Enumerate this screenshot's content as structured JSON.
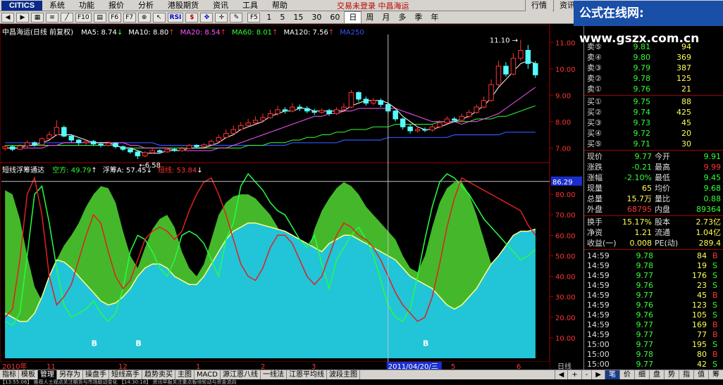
{
  "menubar": {
    "logo": "CITICS",
    "items": [
      "系统",
      "功能",
      "报价",
      "分析",
      "港股期货",
      "资讯",
      "工具",
      "帮助"
    ],
    "status": "交易未登录  中昌海运",
    "right_buttons": [
      "行情",
      "资讯"
    ]
  },
  "toolbar": {
    "icons": [
      "back-icon",
      "forward-icon",
      "grid-icon",
      "list-icon",
      "chart-icon",
      "f10-icon",
      "draw-icon",
      "f6-icon",
      "f7-icon",
      "zoom-icon",
      "cursor-icon",
      "rsi-icon",
      "dollar-icon",
      "move-icon",
      "cross-icon",
      "pen-icon"
    ],
    "btn_labels": [
      "",
      "",
      "",
      "",
      "",
      "F10",
      "",
      "F6",
      "F7",
      "",
      "",
      "RSI",
      "$",
      "",
      "",
      ""
    ],
    "f5": "F5",
    "periods": [
      "1",
      "5",
      "15",
      "30",
      "60",
      "日",
      "周",
      "月",
      "多",
      "季",
      "年"
    ],
    "active_period": "日"
  },
  "watermark": "公式在线网: www.gszx.com.cn",
  "main_chart": {
    "title": "中昌海运(日线 前复权)",
    "ma": [
      {
        "label": "MA5: 8.74",
        "arrow": "↓",
        "color": "#ffffff"
      },
      {
        "label": "MA10: 8.80",
        "arrow": "↑",
        "color": "#ffffff"
      },
      {
        "label": "MA20: 8.54",
        "arrow": "↑",
        "color": "#ff55ff"
      },
      {
        "label": "MA60: 8.01",
        "arrow": "↑",
        "color": "#33ff33"
      },
      {
        "label": "MA120: 7.56",
        "arrow": "↑",
        "color": "#ffffff"
      },
      {
        "label": "MA250",
        "arrow": "",
        "color": "#3355ff"
      }
    ],
    "y_ticks": [
      "11.00",
      "10.00",
      "9.00",
      "8.00",
      "7.00"
    ],
    "high_label": "11.10",
    "low_label": "6.58",
    "up_color": "#ff3333",
    "down_color": "#55ffff"
  },
  "indicator": {
    "name": "短线浮筹通达",
    "fields": [
      {
        "label": "空方: 49.79",
        "arrow": "↑",
        "color": "#33ff33"
      },
      {
        "label": "浮筹A: 57.45",
        "arrow": "↓",
        "color": "#ffffff"
      },
      {
        "label": "短线: 53.84",
        "arrow": "↓",
        "color": "#ff3333"
      }
    ],
    "cursor_value": "86.29",
    "y_ticks": [
      "80.00",
      "70.00",
      "60.00",
      "50.00",
      "40.00",
      "30.00",
      "20.00",
      "10.00"
    ],
    "b_marker": "B"
  },
  "x_axis": {
    "labels": [
      "2010年",
      "11",
      "12",
      "1",
      "2",
      "3",
      "4",
      "5",
      "6"
    ],
    "cursor_date": "2011/04/20/三",
    "period": "日线"
  },
  "chart_data": {
    "type": "candlestick",
    "price_range": [
      6.5,
      11.3
    ],
    "indicator_range": [
      0,
      90
    ],
    "candles": [
      {
        "o": 6.98,
        "c": 7.05,
        "h": 7.12,
        "l": 6.9
      },
      {
        "o": 7.05,
        "c": 6.95,
        "h": 7.1,
        "l": 6.88
      },
      {
        "o": 6.95,
        "c": 7.08,
        "h": 7.15,
        "l": 6.92
      },
      {
        "o": 7.08,
        "c": 7.2,
        "h": 7.28,
        "l": 7.02
      },
      {
        "o": 7.2,
        "c": 7.12,
        "h": 7.25,
        "l": 7.05
      },
      {
        "o": 7.12,
        "c": 7.35,
        "h": 7.4,
        "l": 7.1
      },
      {
        "o": 7.35,
        "c": 7.5,
        "h": 7.62,
        "l": 7.3
      },
      {
        "o": 7.5,
        "c": 7.78,
        "h": 8.05,
        "l": 7.45
      },
      {
        "o": 7.78,
        "c": 7.45,
        "h": 7.85,
        "l": 7.4
      },
      {
        "o": 7.45,
        "c": 7.3,
        "h": 7.5,
        "l": 7.22
      },
      {
        "o": 7.3,
        "c": 7.2,
        "h": 7.35,
        "l": 7.1
      },
      {
        "o": 7.2,
        "c": 7.25,
        "h": 7.32,
        "l": 7.12
      },
      {
        "o": 7.25,
        "c": 7.15,
        "h": 7.3,
        "l": 7.08
      },
      {
        "o": 7.15,
        "c": 7.1,
        "h": 7.22,
        "l": 7.02
      },
      {
        "o": 7.1,
        "c": 7.18,
        "h": 7.25,
        "l": 7.05
      },
      {
        "o": 7.18,
        "c": 7.05,
        "h": 7.22,
        "l": 6.98
      },
      {
        "o": 7.05,
        "c": 6.95,
        "h": 7.1,
        "l": 6.88
      },
      {
        "o": 6.95,
        "c": 6.85,
        "h": 7.0,
        "l": 6.78
      },
      {
        "o": 6.85,
        "c": 6.7,
        "h": 6.9,
        "l": 6.58
      },
      {
        "o": 6.7,
        "c": 6.82,
        "h": 6.88,
        "l": 6.65
      },
      {
        "o": 6.82,
        "c": 6.9,
        "h": 6.98,
        "l": 6.78
      },
      {
        "o": 6.9,
        "c": 6.85,
        "h": 6.95,
        "l": 6.8
      },
      {
        "o": 6.85,
        "c": 6.95,
        "h": 7.02,
        "l": 6.82
      },
      {
        "o": 6.95,
        "c": 6.9,
        "h": 7.0,
        "l": 6.85
      },
      {
        "o": 6.9,
        "c": 6.98,
        "h": 7.05,
        "l": 6.86
      },
      {
        "o": 6.98,
        "c": 7.1,
        "h": 7.15,
        "l": 6.95
      },
      {
        "o": 7.1,
        "c": 7.05,
        "h": 7.14,
        "l": 7.0
      },
      {
        "o": 7.05,
        "c": 7.12,
        "h": 7.18,
        "l": 7.02
      },
      {
        "o": 7.12,
        "c": 7.25,
        "h": 7.32,
        "l": 7.1
      },
      {
        "o": 7.25,
        "c": 7.4,
        "h": 7.5,
        "l": 7.22
      },
      {
        "o": 7.4,
        "c": 7.55,
        "h": 7.7,
        "l": 7.35
      },
      {
        "o": 7.55,
        "c": 7.7,
        "h": 7.85,
        "l": 7.5
      },
      {
        "o": 7.7,
        "c": 7.85,
        "h": 7.98,
        "l": 7.65
      },
      {
        "o": 7.85,
        "c": 7.95,
        "h": 8.1,
        "l": 7.78
      },
      {
        "o": 7.95,
        "c": 8.05,
        "h": 8.2,
        "l": 7.9
      },
      {
        "o": 8.05,
        "c": 8.15,
        "h": 8.3,
        "l": 8.0
      },
      {
        "o": 8.15,
        "c": 8.3,
        "h": 8.45,
        "l": 8.1
      },
      {
        "o": 8.3,
        "c": 8.45,
        "h": 8.6,
        "l": 8.22
      },
      {
        "o": 8.45,
        "c": 8.4,
        "h": 8.55,
        "l": 8.3
      },
      {
        "o": 8.4,
        "c": 8.55,
        "h": 8.7,
        "l": 8.35
      },
      {
        "o": 8.55,
        "c": 8.5,
        "h": 8.65,
        "l": 8.4
      },
      {
        "o": 8.5,
        "c": 8.4,
        "h": 8.58,
        "l": 8.32
      },
      {
        "o": 8.4,
        "c": 8.35,
        "h": 8.48,
        "l": 8.25
      },
      {
        "o": 8.35,
        "c": 8.42,
        "h": 8.5,
        "l": 8.3
      },
      {
        "o": 8.42,
        "c": 8.3,
        "h": 8.48,
        "l": 8.22
      },
      {
        "o": 8.3,
        "c": 8.45,
        "h": 8.55,
        "l": 8.25
      },
      {
        "o": 8.45,
        "c": 8.55,
        "h": 8.7,
        "l": 8.4
      },
      {
        "o": 8.55,
        "c": 9.1,
        "h": 9.2,
        "l": 8.5
      },
      {
        "o": 9.1,
        "c": 8.85,
        "h": 9.15,
        "l": 8.75
      },
      {
        "o": 8.85,
        "c": 8.7,
        "h": 8.95,
        "l": 8.6
      },
      {
        "o": 8.7,
        "c": 8.8,
        "h": 8.9,
        "l": 8.62
      },
      {
        "o": 8.8,
        "c": 8.65,
        "h": 8.88,
        "l": 8.55
      },
      {
        "o": 8.65,
        "c": 8.4,
        "h": 8.7,
        "l": 8.3
      },
      {
        "o": 8.4,
        "c": 8.1,
        "h": 8.45,
        "l": 8.0
      },
      {
        "o": 8.1,
        "c": 7.8,
        "h": 8.15,
        "l": 7.7
      },
      {
        "o": 7.8,
        "c": 7.65,
        "h": 7.9,
        "l": 7.55
      },
      {
        "o": 7.65,
        "c": 7.7,
        "h": 7.8,
        "l": 7.58
      },
      {
        "o": 7.7,
        "c": 7.68,
        "h": 7.78,
        "l": 7.6
      },
      {
        "o": 7.68,
        "c": 7.8,
        "h": 7.9,
        "l": 7.62
      },
      {
        "o": 7.8,
        "c": 7.95,
        "h": 8.05,
        "l": 7.75
      },
      {
        "o": 7.95,
        "c": 8.1,
        "h": 8.2,
        "l": 7.9
      },
      {
        "o": 8.1,
        "c": 8.05,
        "h": 8.18,
        "l": 7.98
      },
      {
        "o": 8.05,
        "c": 8.2,
        "h": 8.3,
        "l": 8.0
      },
      {
        "o": 8.2,
        "c": 8.35,
        "h": 8.45,
        "l": 8.15
      },
      {
        "o": 8.35,
        "c": 8.55,
        "h": 8.65,
        "l": 8.3
      },
      {
        "o": 8.55,
        "c": 8.8,
        "h": 8.95,
        "l": 8.5
      },
      {
        "o": 8.8,
        "c": 9.4,
        "h": 9.6,
        "l": 8.75
      },
      {
        "o": 9.4,
        "c": 10.1,
        "h": 10.3,
        "l": 9.35
      },
      {
        "o": 10.1,
        "c": 9.8,
        "h": 10.25,
        "l": 9.7
      },
      {
        "o": 9.8,
        "c": 10.4,
        "h": 10.6,
        "l": 9.75
      },
      {
        "o": 10.4,
        "c": 10.7,
        "h": 11.1,
        "l": 10.3
      },
      {
        "o": 10.7,
        "c": 10.2,
        "h": 10.9,
        "l": 10.0
      },
      {
        "o": 10.2,
        "c": 9.77,
        "h": 10.3,
        "l": 9.65
      }
    ],
    "ma5": [
      7.0,
      7.0,
      7.0,
      7.1,
      7.1,
      7.2,
      7.3,
      7.5,
      7.5,
      7.5,
      7.4,
      7.3,
      7.2,
      7.2,
      7.2,
      7.1,
      7.0,
      7.0,
      6.9,
      6.8,
      6.8,
      6.8,
      6.9,
      6.9,
      6.9,
      7.0,
      7.0,
      7.0,
      7.1,
      7.2,
      7.4,
      7.5,
      7.7,
      7.8,
      7.9,
      8.0,
      8.2,
      8.3,
      8.4,
      8.4,
      8.5,
      8.5,
      8.4,
      8.4,
      8.4,
      8.4,
      8.4,
      8.6,
      8.7,
      8.8,
      8.8,
      8.8,
      8.7,
      8.5,
      8.2,
      8.0,
      7.8,
      7.7,
      7.7,
      7.8,
      7.9,
      8.0,
      8.1,
      8.2,
      8.4,
      8.6,
      8.9,
      9.3,
      9.6,
      9.9,
      10.2,
      10.3,
      10.2
    ],
    "ma20": [
      7.0,
      7.0,
      7.0,
      7.0,
      7.0,
      7.0,
      7.1,
      7.1,
      7.2,
      7.2,
      7.2,
      7.2,
      7.2,
      7.2,
      7.2,
      7.2,
      7.2,
      7.1,
      7.1,
      7.0,
      7.0,
      7.0,
      7.0,
      6.9,
      6.9,
      6.9,
      6.9,
      6.9,
      6.9,
      7.0,
      7.0,
      7.1,
      7.2,
      7.3,
      7.4,
      7.5,
      7.6,
      7.7,
      7.8,
      7.9,
      8.0,
      8.1,
      8.2,
      8.2,
      8.3,
      8.3,
      8.4,
      8.4,
      8.5,
      8.5,
      8.5,
      8.5,
      8.5,
      8.5,
      8.4,
      8.3,
      8.2,
      8.1,
      8.0,
      8.0,
      8.0,
      8.0,
      7.9,
      8.0,
      8.0,
      8.1,
      8.2,
      8.3,
      8.5,
      8.7,
      8.9,
      9.1,
      9.3
    ],
    "ma60": [
      7.1,
      7.1,
      7.1,
      7.1,
      7.1,
      7.1,
      7.1,
      7.1,
      7.1,
      7.1,
      7.1,
      7.1,
      7.1,
      7.1,
      7.1,
      7.1,
      7.0,
      7.0,
      7.0,
      7.0,
      7.0,
      7.0,
      7.0,
      7.0,
      7.0,
      7.0,
      7.0,
      7.0,
      7.0,
      7.0,
      7.0,
      7.0,
      7.0,
      7.1,
      7.1,
      7.1,
      7.2,
      7.2,
      7.2,
      7.3,
      7.3,
      7.4,
      7.4,
      7.5,
      7.5,
      7.6,
      7.6,
      7.7,
      7.7,
      7.7,
      7.8,
      7.8,
      7.8,
      7.9,
      7.9,
      7.9,
      7.9,
      7.9,
      7.9,
      8.0,
      8.0,
      8.0,
      8.0,
      8.0,
      8.1,
      8.1,
      8.1,
      8.2,
      8.2,
      8.3,
      8.4,
      8.5,
      8.6
    ],
    "ma120": [
      7.2,
      7.2,
      7.2,
      7.2,
      7.2,
      7.2,
      7.2,
      7.2,
      7.2,
      7.2,
      7.2,
      7.2,
      7.2,
      7.2,
      7.2,
      7.2,
      7.2,
      7.2,
      7.2,
      7.2,
      7.2,
      7.1,
      7.1,
      7.1,
      7.1,
      7.1,
      7.1,
      7.1,
      7.1,
      7.1,
      7.1,
      7.1,
      7.1,
      7.1,
      7.1,
      7.1,
      7.1,
      7.1,
      7.1,
      7.2,
      7.2,
      7.2,
      7.2,
      7.2,
      7.2,
      7.2,
      7.3,
      7.3,
      7.3,
      7.3,
      7.3,
      7.3,
      7.4,
      7.4,
      7.4,
      7.4,
      7.4,
      7.4,
      7.4,
      7.4,
      7.4,
      7.5,
      7.5,
      7.5,
      7.5,
      7.5,
      7.5,
      7.5,
      7.6,
      7.6,
      7.6,
      7.6,
      7.6
    ],
    "kongfang": [
      82,
      80,
      68,
      50,
      35,
      28,
      38,
      48,
      55,
      60,
      66,
      74,
      80,
      84,
      83,
      76,
      62,
      50,
      44,
      54,
      63,
      68,
      70,
      64,
      52,
      44,
      40,
      46,
      58,
      70,
      76,
      79,
      80,
      80,
      78,
      74,
      70,
      64,
      55,
      47,
      44,
      50,
      63,
      72,
      78,
      83,
      86,
      84,
      80,
      74,
      70,
      66,
      62,
      58,
      50,
      44,
      42,
      50,
      64,
      76,
      83,
      86,
      86,
      80,
      70,
      58,
      46,
      40,
      44,
      50,
      56,
      60,
      63
    ],
    "fuchou": [
      22,
      20,
      18,
      18,
      22,
      30,
      40,
      48,
      47,
      44,
      40,
      36,
      32,
      28,
      26,
      27,
      30,
      34,
      40,
      44,
      46,
      46,
      44,
      40,
      38,
      36,
      36,
      40,
      46,
      52,
      58,
      62,
      64,
      66,
      66,
      65,
      64,
      63,
      62,
      60,
      58,
      56,
      54,
      52,
      56,
      58,
      60,
      60,
      58,
      56,
      54,
      52,
      50,
      48,
      44,
      40,
      38,
      36,
      34,
      30,
      26,
      24,
      26,
      30,
      34,
      40,
      46,
      50,
      55,
      60,
      62,
      62,
      63
    ],
    "duanxian": [
      18,
      16,
      22,
      50,
      80,
      84,
      66,
      44,
      26,
      20,
      22,
      24,
      28,
      22,
      18,
      22,
      34,
      52,
      60,
      58,
      52,
      44,
      40,
      48,
      60,
      62,
      60,
      56,
      48,
      40,
      58,
      66,
      84,
      90,
      86,
      82,
      76,
      72,
      70,
      64,
      58,
      54,
      60,
      46,
      34,
      48,
      54,
      60,
      64,
      58,
      50,
      38,
      26,
      20,
      18,
      24,
      40,
      58,
      74,
      86,
      90,
      88,
      84,
      80,
      74,
      68,
      64,
      60,
      56,
      52,
      48,
      50,
      53
    ],
    "duanxian_red": [
      20,
      24,
      48,
      80,
      88,
      70,
      40,
      26,
      30,
      36,
      48,
      60,
      70,
      66,
      52,
      40,
      34,
      38,
      48,
      58,
      62,
      64,
      62,
      58,
      62,
      72,
      80,
      86,
      88,
      80,
      70,
      58,
      46,
      40,
      38,
      44,
      54,
      60,
      60,
      56,
      48,
      40,
      36,
      40,
      50,
      60,
      66,
      64,
      60,
      58,
      54,
      48,
      40,
      32,
      26,
      22,
      18,
      20,
      30,
      46,
      64,
      78,
      88,
      86,
      84,
      82,
      80,
      78,
      76,
      74,
      72,
      65,
      60
    ]
  },
  "quote": {
    "sell": [
      {
        "label": "卖⑤",
        "price": "9.81",
        "vol": "94"
      },
      {
        "label": "卖④",
        "price": "9.80",
        "vol": "369"
      },
      {
        "label": "卖③",
        "price": "9.79",
        "vol": "387"
      },
      {
        "label": "卖②",
        "price": "9.78",
        "vol": "125"
      },
      {
        "label": "卖①",
        "price": "9.76",
        "vol": "21"
      }
    ],
    "buy": [
      {
        "label": "买①",
        "price": "9.75",
        "vol": "88"
      },
      {
        "label": "买②",
        "price": "9.74",
        "vol": "425"
      },
      {
        "label": "买③",
        "price": "9.73",
        "vol": "45"
      },
      {
        "label": "买④",
        "price": "9.72",
        "vol": "20"
      },
      {
        "label": "买⑤",
        "price": "9.71",
        "vol": "30"
      }
    ],
    "stats": [
      {
        "l1": "现价",
        "v1": "9.77",
        "l2": "今开",
        "v2": "9.91",
        "c1": "#33ff33",
        "c2": "#33ff33"
      },
      {
        "l1": "涨跌",
        "v1": "-0.21",
        "l2": "最高",
        "v2": "9.99",
        "c1": "#33ff33",
        "c2": "#ff3333"
      },
      {
        "l1": "涨幅",
        "v1": "-2.10%",
        "l2": "最低",
        "v2": "9.45",
        "c1": "#33ff33",
        "c2": "#33ff33"
      },
      {
        "l1": "现量",
        "v1": "65",
        "l2": "均价",
        "v2": "9.68",
        "c1": "#ffff55",
        "c2": "#33ff33"
      },
      {
        "l1": "总量",
        "v1": "15.7万",
        "l2": "量比",
        "v2": "0.88",
        "c1": "#ffff55",
        "c2": "#33ff33"
      },
      {
        "l1": "外盘",
        "v1": "68795",
        "l2": "内盘",
        "v2": "89364",
        "c1": "#ff3333",
        "c2": "#33ff33"
      }
    ],
    "stats2": [
      {
        "l1": "换手",
        "v1": "15.17%",
        "l2": "股本",
        "v2": "2.73亿"
      },
      {
        "l1": "净资",
        "v1": "1.21",
        "l2": "流通",
        "v2": "1.04亿"
      },
      {
        "l1": "收益(一)",
        "v1": "0.008",
        "l2": "PE(动)",
        "v2": "289.4"
      }
    ],
    "ticks": [
      {
        "time": "14:59",
        "price": "9.78",
        "vol": "84",
        "side": "B"
      },
      {
        "time": "14:59",
        "price": "9.78",
        "vol": "19",
        "side": "S"
      },
      {
        "time": "14:59",
        "price": "9.77",
        "vol": "176",
        "side": "S"
      },
      {
        "time": "14:59",
        "price": "9.76",
        "vol": "23",
        "side": "S"
      },
      {
        "time": "14:59",
        "price": "9.77",
        "vol": "45",
        "side": "B"
      },
      {
        "time": "14:59",
        "price": "9.76",
        "vol": "123",
        "side": "S"
      },
      {
        "time": "14:59",
        "price": "9.76",
        "vol": "105",
        "side": "S"
      },
      {
        "time": "14:59",
        "price": "9.77",
        "vol": "169",
        "side": "B"
      },
      {
        "time": "14:59",
        "price": "9.77",
        "vol": "77",
        "side": "B"
      },
      {
        "time": "15:00",
        "price": "9.77",
        "vol": "195",
        "side": "S"
      },
      {
        "time": "15:00",
        "price": "9.78",
        "vol": "80",
        "side": "B"
      },
      {
        "time": "15:00",
        "price": "9.77",
        "vol": "42",
        "side": "S"
      }
    ]
  },
  "bottom_tabs": [
    "指标",
    "模板",
    "管理",
    "另存为",
    "操盘手",
    "短线高手",
    "趋势卖买",
    "主图",
    "MACD",
    "源江恩八线",
    "一线法",
    "江恩平均线",
    "波段主图"
  ],
  "active_tab": "管理",
  "right_tabs": [
    "笔",
    "价",
    "细",
    "盘",
    "势",
    "指",
    "值",
    "筹"
  ],
  "active_right_tab": "笔",
  "ticker": "【13:55:06】 推荐人士观点关注期货与市场联动变化   【14:30:18】 资讯早报关注重点板块轮动与资金流向"
}
